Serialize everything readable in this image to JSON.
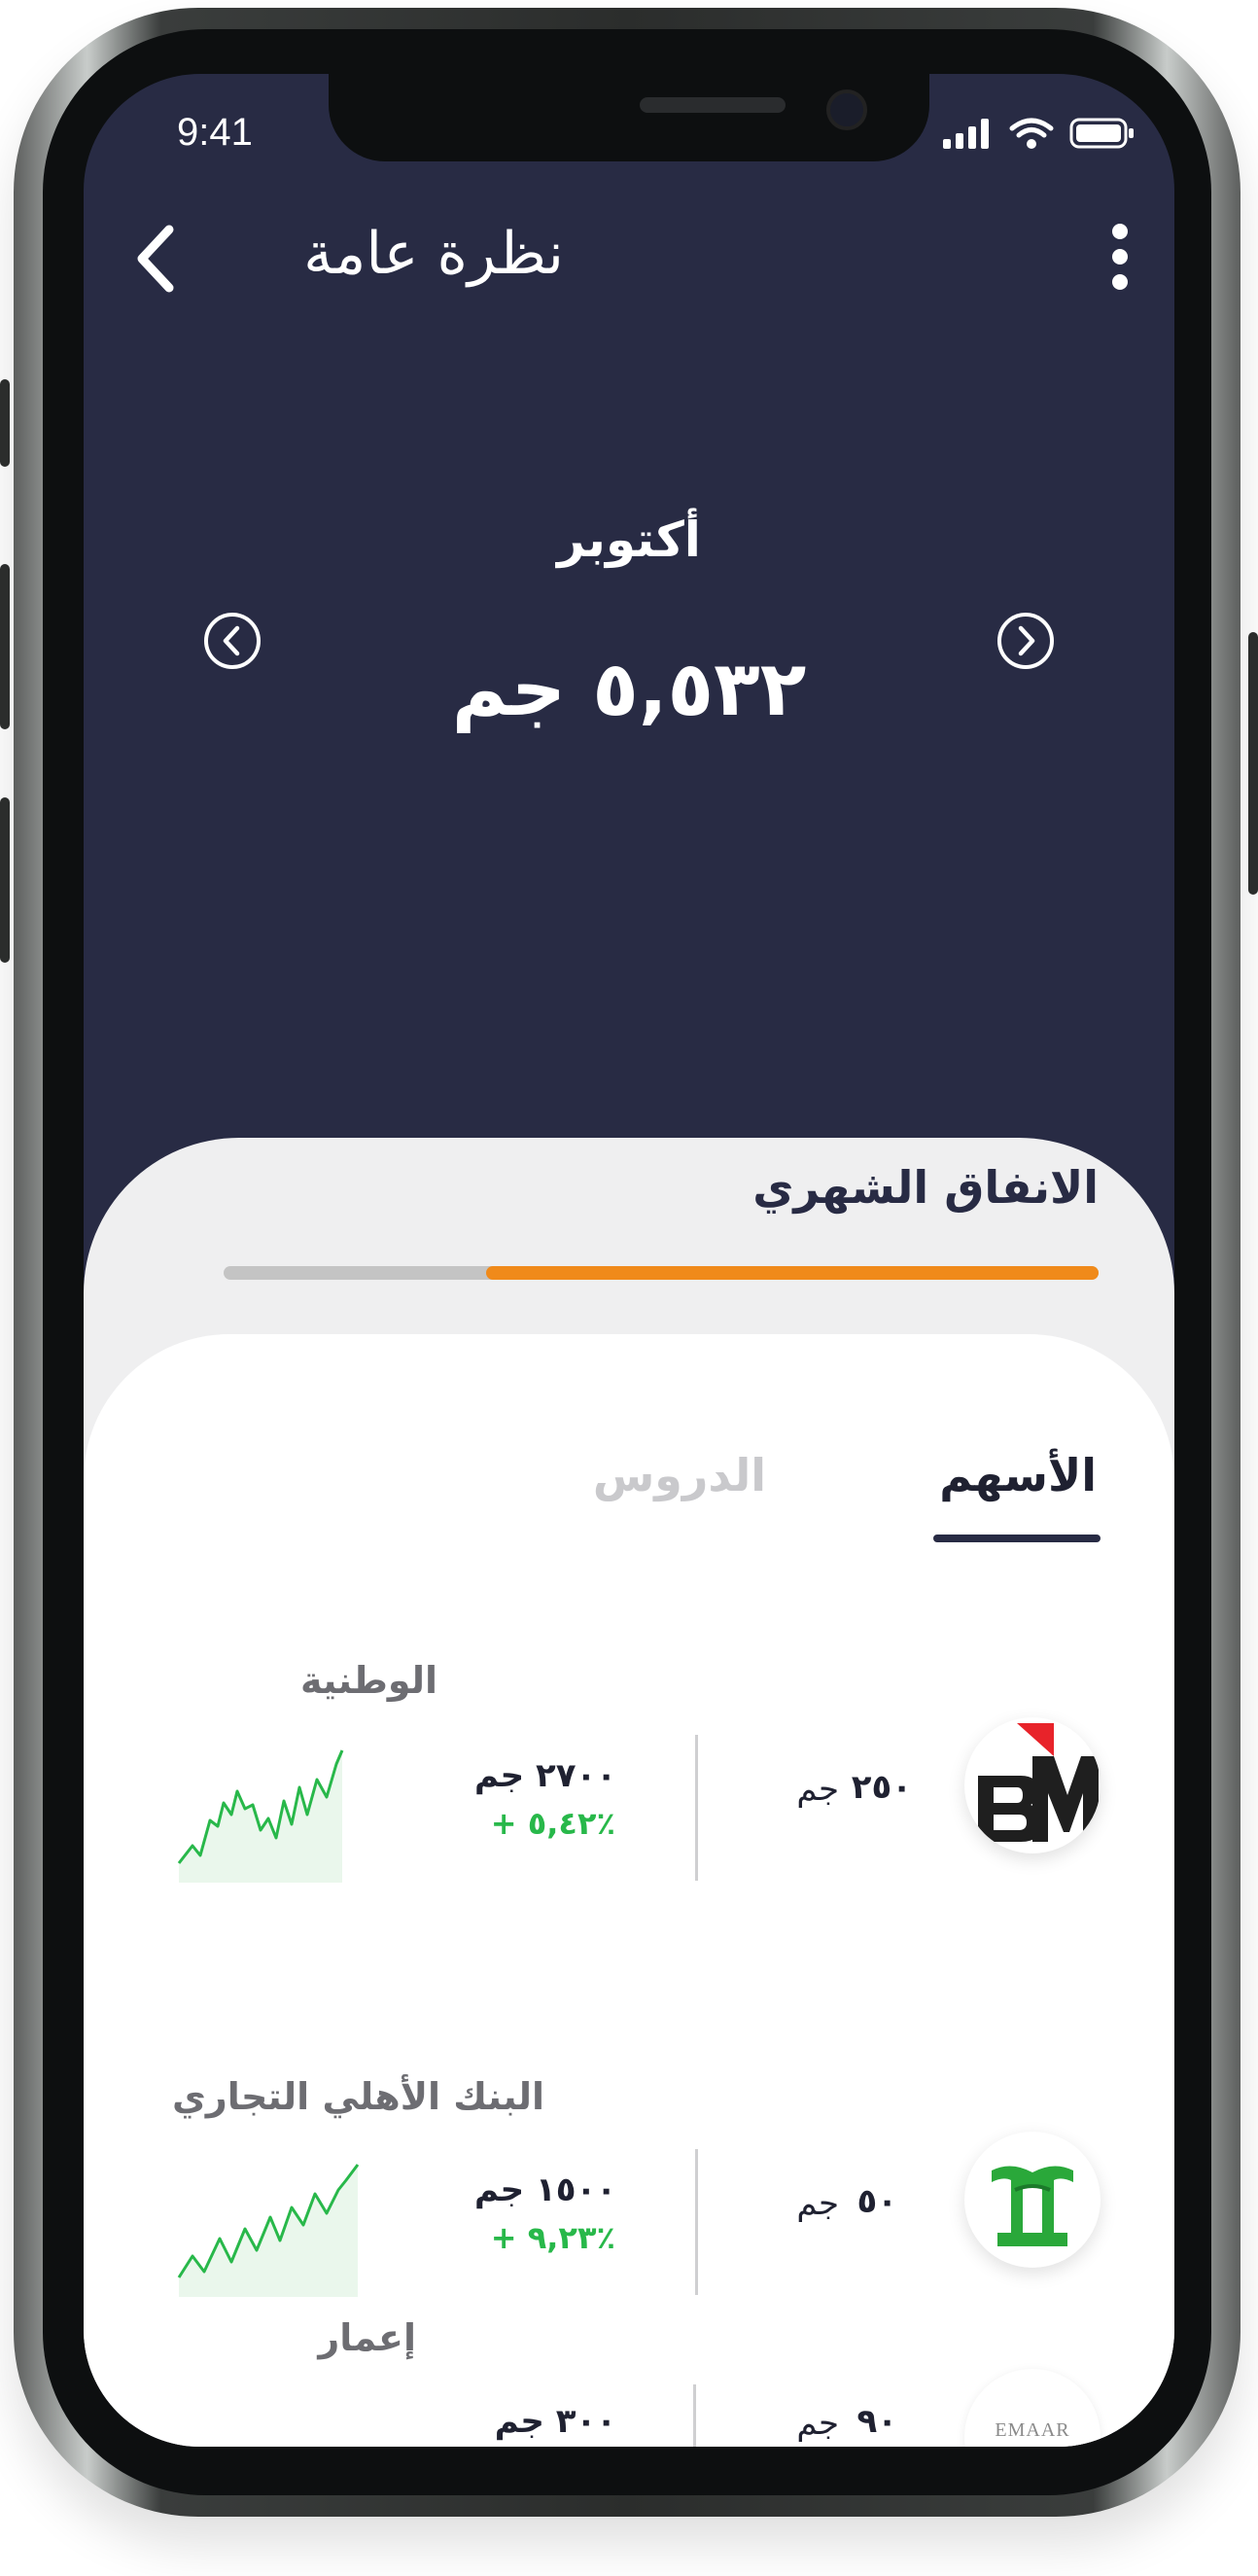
{
  "status": {
    "time": "9:41"
  },
  "header": {
    "title": "نظرة عامة"
  },
  "summary": {
    "month": "أكتوبر",
    "amount": "٥,٥٣٢ جم"
  },
  "spending": {
    "title": "الانفاق الشهري",
    "progress": 0.7
  },
  "tabs": [
    {
      "label": "الأسهم",
      "active": true
    },
    {
      "label": "الدروس",
      "active": false
    }
  ],
  "stocks": [
    {
      "name": "الوطنية",
      "owned_amount": "٢٥٠",
      "unit": "جم",
      "price": "٢٧٠٠ جم",
      "change": "+ ٥,٤٢٪",
      "logo": "bm-logo"
    },
    {
      "name": "البنك الأهلي التجاري",
      "owned_amount": "٥٠",
      "unit": "جم",
      "price": "١٥٠٠ جم",
      "change": "+ ٩,٢٣٪",
      "logo": "ncb-logo"
    },
    {
      "name": "إعمار",
      "owned_amount": "٩٠",
      "unit": "جم",
      "price": "٣٠٠ جم",
      "change": "",
      "logo": "emaar-logo",
      "logo_text": "EMAAR"
    }
  ],
  "colors": {
    "header_bg": "#282b44",
    "accent": "#f08a1a",
    "positive": "#28b84a"
  },
  "icons": [
    "back-arrow-icon",
    "more-vertical-icon",
    "chevron-left-circle-icon",
    "chevron-right-circle-icon",
    "signal-icon",
    "wifi-icon",
    "battery-icon"
  ]
}
